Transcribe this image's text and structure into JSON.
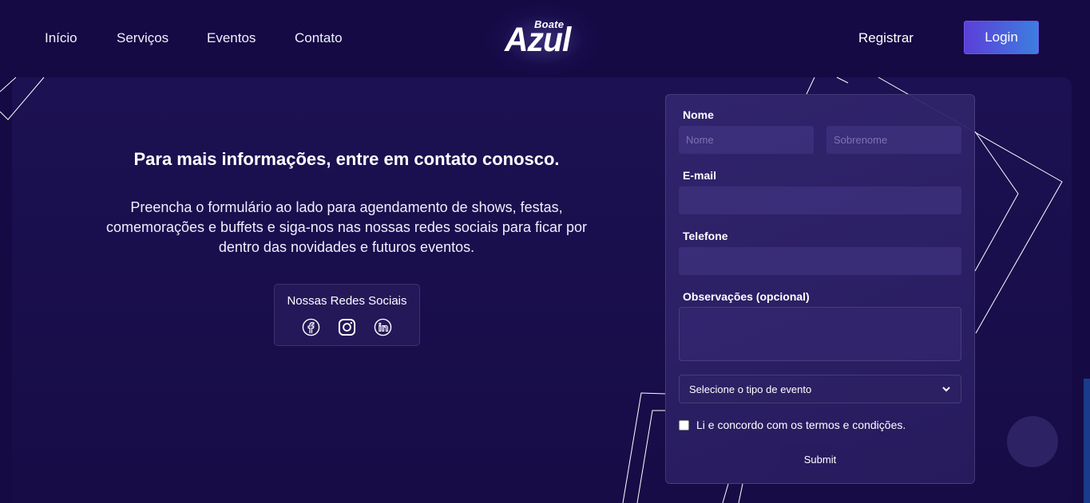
{
  "nav": {
    "links": [
      "Início",
      "Serviços",
      "Eventos",
      "Contato"
    ],
    "logo_small": "Boate",
    "logo_big": "Azul",
    "register": "Registrar",
    "login": "Login"
  },
  "info": {
    "heading": "Para mais informações, entre em contato conosco.",
    "description": "Preencha o formulário ao lado para agendamento de shows, festas, comemorações e buffets e siga-nos nas nossas redes sociais para ficar por dentro das novidades e futuros eventos.",
    "social_title": "Nossas Redes Sociais",
    "social_icons": [
      "facebook-icon",
      "instagram-icon",
      "linkedin-icon"
    ]
  },
  "form": {
    "name_label": "Nome",
    "first_name_placeholder": "Nome",
    "last_name_placeholder": "Sobrenome",
    "email_label": "E-mail",
    "phone_label": "Telefone",
    "notes_label": "Observações (opcional)",
    "event_type_selected": "Selecione o tipo de evento",
    "terms_label": "Li e concordo com os termos e condições.",
    "submit_label": "Submit"
  },
  "colors": {
    "background": "#150a44",
    "login_gradient_start": "#5b3fd8",
    "login_gradient_end": "#3d7ee0"
  }
}
